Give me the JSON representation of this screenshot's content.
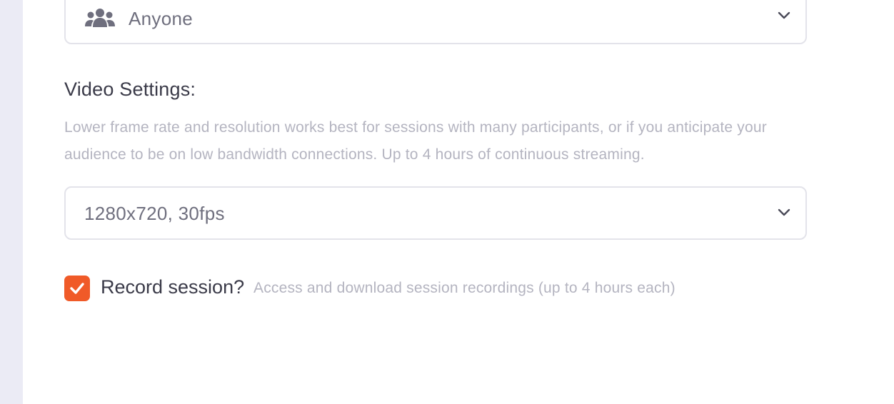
{
  "audience": {
    "selected": "Anyone",
    "icon": "users-icon"
  },
  "video_settings": {
    "title": "Video Settings:",
    "description": "Lower frame rate and resolution works best for sessions with many participants, or if you anticipate your audience to be on low bandwidth connections. Up to 4 hours of continuous streaming.",
    "selected": "1280x720, 30fps"
  },
  "recording": {
    "label": "Record session?",
    "hint": "Access and download session recordings (up to 4 hours each)",
    "checked": true
  },
  "colors": {
    "accent": "#f05a28",
    "rail": "#ebebf5",
    "border": "#e3e3ea",
    "text_primary": "#3a3a48",
    "text_muted": "#b4b4c0"
  }
}
